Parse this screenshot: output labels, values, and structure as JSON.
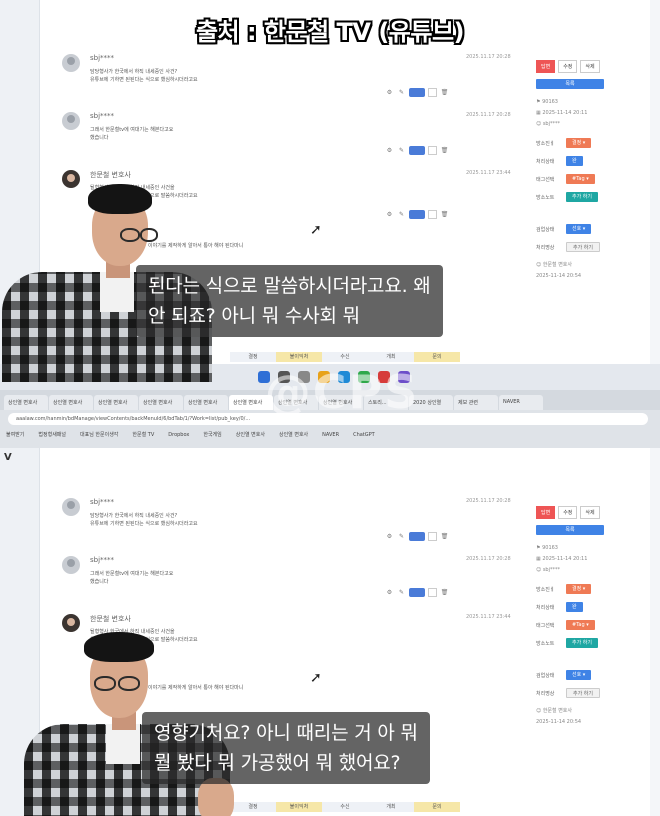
{
  "banner": {
    "text": "출처 : 한문철 TV (유튜브)"
  },
  "watermark": {
    "text": "@CPS"
  },
  "comments": [
    {
      "author": "sbj****",
      "time": "2025.11.17 20:28",
      "line1": "담당형사가 한국에서 하직 내세중인 사건?",
      "line2": "유튜브에 기하면 된된다는 식으로 했심하시더라고요"
    },
    {
      "author": "sbj****",
      "time": "2025.11.17 20:28",
      "line1": "그래서 한문철tv에 여대기는 해본다고요",
      "line2": "했습니다"
    },
    {
      "author": "한문철 변호사",
      "time": "2025.11.17 23:44",
      "line1": "될형형사 한국에서 하직 내세중인 사건을",
      "line2": "유튜브에 기하면 된된다는 식으로 말씀하시더라고요",
      "line3": "이야기를 제작하게 알아서 통아 해야 된다마니"
    }
  ],
  "sidebar": {
    "tab_buttons": [
      "답변",
      "수정",
      "삭제"
    ],
    "primary_button": "목록",
    "id_value": "90163",
    "date_value": "2025-11-14 20:11",
    "user_value": "sbj****",
    "rows": [
      {
        "label": "방소진ㅔ",
        "value": "결정 ▾"
      },
      {
        "label": "처리상태",
        "value": "완"
      },
      {
        "label": "태그선택",
        "value": "#Tag ▾"
      },
      {
        "label": "방소노트",
        "value": "추가 하기"
      },
      {
        "label": "검업상태",
        "value": "선호 ▾"
      },
      {
        "label": "처리명상",
        "value": "추가 하기"
      }
    ],
    "footer_name": "한문철 변호사",
    "footer_date": "2025-11-14 20:54"
  },
  "pagebar": [
    "결정",
    "불이익처",
    "수신",
    "개최",
    "문의"
  ],
  "browser": {
    "tabs": [
      "상인열 변호사",
      "상인열 변호사",
      "상인열 변호사",
      "상인열 변호사",
      "상인열 변호사",
      "상인열 변호사",
      "상인열 변호사",
      "상인열 변호사",
      "스토리...",
      "2020 상인열",
      "제보 관련",
      "NAVER"
    ],
    "url": "aaalaw.com/hanmin/bdManage/viewContents/backMenuId/6/bdTab/1/?Work=list/pub_key/0/...",
    "bookmarks": [
      "불여받기",
      "법정형새패널",
      "대표님 한문이생각",
      "한문철 TV",
      "Dropbox",
      "한국게임",
      "상인열 변호사",
      "상인열 변호사",
      "NAVER",
      "ChatGPT"
    ]
  },
  "subtitles": {
    "top": "된다는 식으로 말씀하시더라고요. 왜\n안 되죠? 아니 뭐 수사회 뭐",
    "bottom": "영향기처요? 아니 때리는 거 아 뭐\n뭘 봤다 뭐 가공했어 뭐 했어요?"
  },
  "left_marker": "V",
  "colors": {
    "accent_blue": "#3f83e6",
    "accent_orange": "#ef7a55",
    "accent_red": "#ee5555",
    "accent_teal": "#1fa7a3"
  }
}
